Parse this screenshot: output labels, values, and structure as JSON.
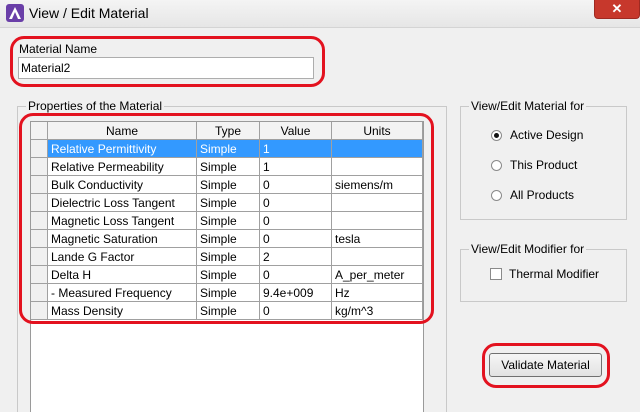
{
  "window": {
    "title": "View / Edit Material",
    "close_glyph": "✕"
  },
  "material_name": {
    "label": "Material Name",
    "value": "Material2"
  },
  "properties": {
    "legend": "Properties of the Material",
    "columns": [
      "Name",
      "Type",
      "Value",
      "Units"
    ],
    "selected_row": 0,
    "rows": [
      {
        "name": "Relative Permittivity",
        "type": "Simple",
        "value": "1",
        "units": ""
      },
      {
        "name": "Relative Permeability",
        "type": "Simple",
        "value": "1",
        "units": ""
      },
      {
        "name": "Bulk Conductivity",
        "type": "Simple",
        "value": "0",
        "units": "siemens/m"
      },
      {
        "name": "Dielectric Loss Tangent",
        "type": "Simple",
        "value": "0",
        "units": ""
      },
      {
        "name": "Magnetic Loss Tangent",
        "type": "Simple",
        "value": "0",
        "units": ""
      },
      {
        "name": "Magnetic Saturation",
        "type": "Simple",
        "value": "0",
        "units": "tesla"
      },
      {
        "name": "Lande G Factor",
        "type": "Simple",
        "value": "2",
        "units": ""
      },
      {
        "name": "Delta H",
        "type": "Simple",
        "value": "0",
        "units": "A_per_meter"
      },
      {
        "name": "- Measured Frequency",
        "type": "Simple",
        "value": "9.4e+009",
        "units": "Hz"
      },
      {
        "name": "Mass Density",
        "type": "Simple",
        "value": "0",
        "units": "kg/m^3"
      }
    ]
  },
  "edit_for": {
    "legend": "View/Edit Material for",
    "options": [
      {
        "label": "Active Design",
        "checked": true
      },
      {
        "label": "This Product",
        "checked": false
      },
      {
        "label": "All Products",
        "checked": false
      }
    ]
  },
  "modifier_for": {
    "legend": "View/Edit Modifier for",
    "thermal_label": "Thermal Modifier",
    "thermal_checked": false
  },
  "validate_button": {
    "label": "Validate Material"
  },
  "colors": {
    "selection": "#3399ff",
    "annotation": "#e3121f",
    "close_button": "#c7382c"
  },
  "icons": {
    "app": "ansys-logo-icon",
    "close": "close-icon"
  }
}
